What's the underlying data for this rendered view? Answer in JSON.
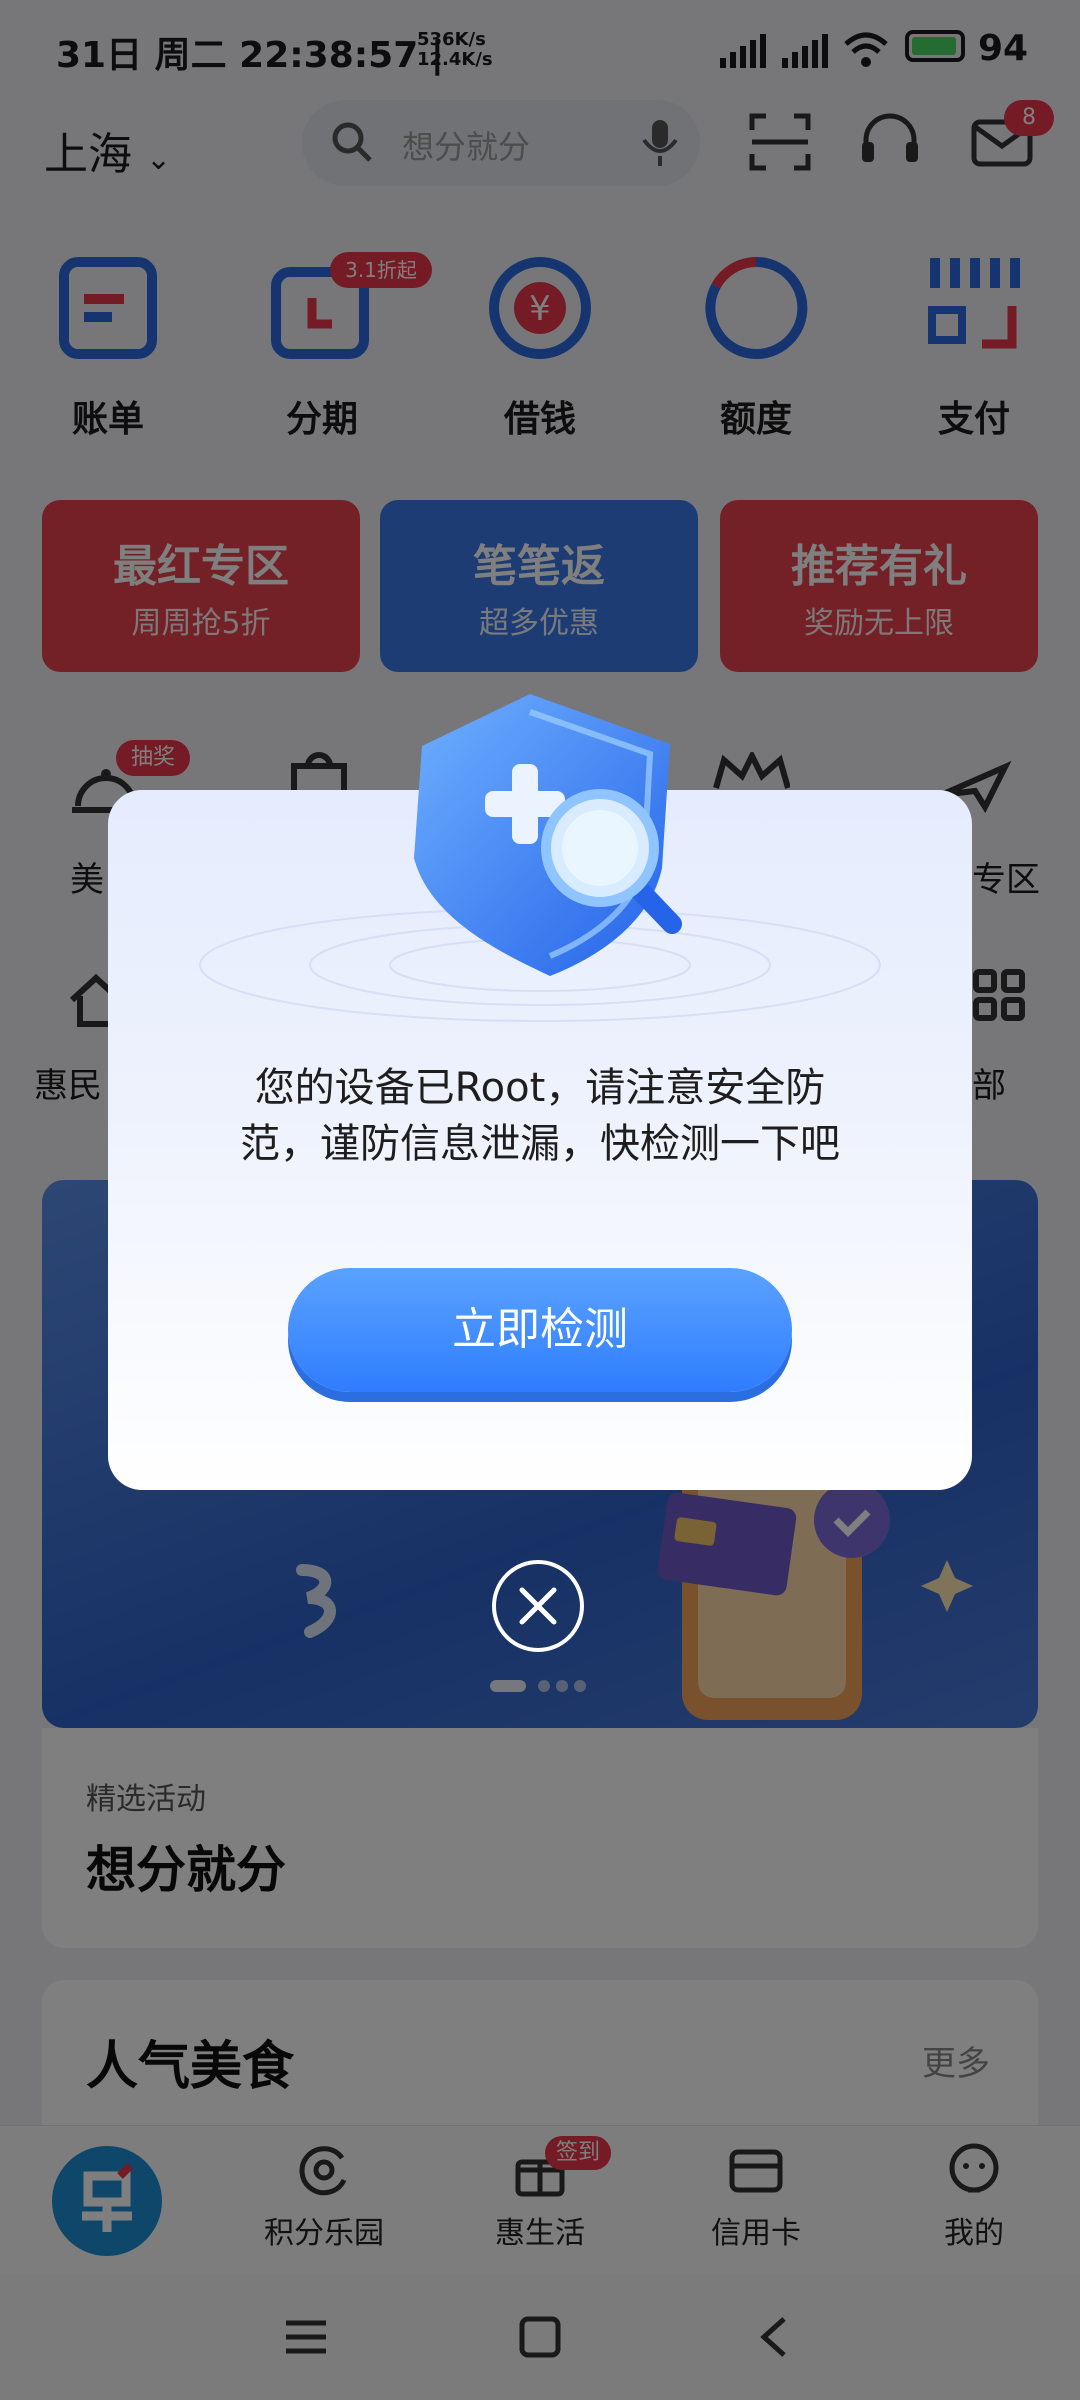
{
  "status_bar": {
    "time": "31日 周二 22:38:57 |",
    "net_up": "536K/s",
    "net_down": "12.4K/s",
    "battery": "94"
  },
  "header": {
    "city": "上海",
    "search_placeholder": "想分就分",
    "message_count": "8"
  },
  "quick_menu": [
    {
      "label": "账单"
    },
    {
      "label": "分期",
      "badge": "3.1折起"
    },
    {
      "label": "借钱"
    },
    {
      "label": "额度"
    },
    {
      "label": "支付"
    }
  ],
  "promos": [
    {
      "title": "最红专区",
      "subtitle": "周周抢5折",
      "color": "#e8404e"
    },
    {
      "title": "笔笔返",
      "subtitle": "超多优惠",
      "color": "#3a78e6"
    },
    {
      "title": "推荐有礼",
      "subtitle": "奖励无上限",
      "color": "#e8404e"
    }
  ],
  "second_row": {
    "badge": "抽奖",
    "label_left_partial": "美",
    "label_right_partial": "专区",
    "label_left2_partial": "惠民",
    "label_right2_partial": "部"
  },
  "activity": {
    "caption": "精选活动",
    "title": "想分就分"
  },
  "food_section": {
    "title": "人气美食",
    "more": "更多"
  },
  "bottom_nav": [
    {
      "label": "积分乐园"
    },
    {
      "label": "惠生活",
      "badge": "签到"
    },
    {
      "label": "信用卡"
    },
    {
      "label": "我的"
    }
  ],
  "dialog": {
    "message_line1": "您的设备已Root，请注意安全防",
    "message_line2": "范，谨防信息泄漏，快检测一下吧",
    "button": "立即检测"
  },
  "colors": {
    "brand_blue": "#2f7dff",
    "brand_red": "#e8374a"
  }
}
